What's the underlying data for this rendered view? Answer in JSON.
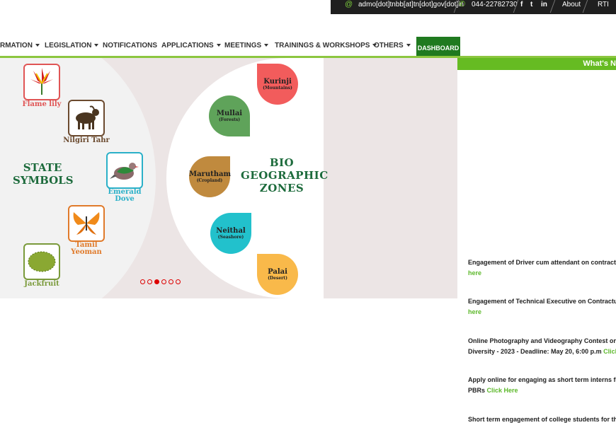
{
  "topbar": {
    "email": "admo[dot]tnbb[at]tn[dot]gov[dot]in",
    "phone": "044-22782730",
    "social": [
      "f",
      "t",
      "in"
    ],
    "links": [
      "About",
      "RTI"
    ],
    "icons": [
      "at-icon",
      "phone-icon",
      "facebook-icon",
      "twitter-icon",
      "linkedin-icon"
    ]
  },
  "nav": {
    "items": [
      {
        "label": "RMATION",
        "dropdown": true
      },
      {
        "label": "LEGISLATION",
        "dropdown": true
      },
      {
        "label": "NOTIFICATIONS",
        "dropdown": false
      },
      {
        "label": "APPLICATIONS",
        "dropdown": true
      },
      {
        "label": "MEETINGS",
        "dropdown": true
      },
      {
        "label": "TRAININGS & WORKSHOPS",
        "dropdown": true
      },
      {
        "label": "OTHERS",
        "dropdown": true
      }
    ],
    "dashboard": "DASHBOARD"
  },
  "slider": {
    "state_title": "STATE SYMBOLS",
    "bio_title": "BIO GEOGRAPHIC ZONES",
    "symbols": [
      {
        "name": "Flame lily",
        "color": "#e05555"
      },
      {
        "name": "Nilgiri Tahr",
        "color": "#6b4a2f"
      },
      {
        "name": "Emerald Dove",
        "color": "#2ab0c8"
      },
      {
        "name": "Tamil Yeoman",
        "color": "#e07a2a"
      },
      {
        "name": "Jackfruit",
        "color": "#7a9a3a"
      }
    ],
    "zones": [
      {
        "name": "Kurinji",
        "sub": "(Mountains)",
        "color": "#f25c5c"
      },
      {
        "name": "Mullai",
        "sub": "(Forests)",
        "color": "#5fa35a"
      },
      {
        "name": "Marutham",
        "sub": "(Cropland)",
        "color": "#c08a3e"
      },
      {
        "name": "Neithal",
        "sub": "(Seashore)",
        "color": "#22c1cc"
      },
      {
        "name": "Palai",
        "sub": "(Desert)",
        "color": "#f9b94a"
      }
    ],
    "dots": 6,
    "active_dot": 3
  },
  "whatsnew": {
    "title": "What's N",
    "items": [
      {
        "line1": "Engagement of Driver cum attendant on contractua",
        "line2_text": "",
        "line2_link": "here"
      },
      {
        "line1": "Engagement of Technical Executive on Contractual",
        "line2_text": "",
        "line2_link": "here"
      },
      {
        "line1": "Online Photography and Videography Contest on th",
        "line2_text": "Diversity - 2023 - Deadline: May 20, 6:00 p.m ",
        "line2_link": "Click"
      },
      {
        "line1": "Apply online for engaging as short term interns for",
        "line2_text": "PBRs ",
        "line2_link": "Click Here"
      },
      {
        "line1": "Short term engagement of college students for the",
        "line2_text": "",
        "line2_link": ""
      }
    ]
  }
}
